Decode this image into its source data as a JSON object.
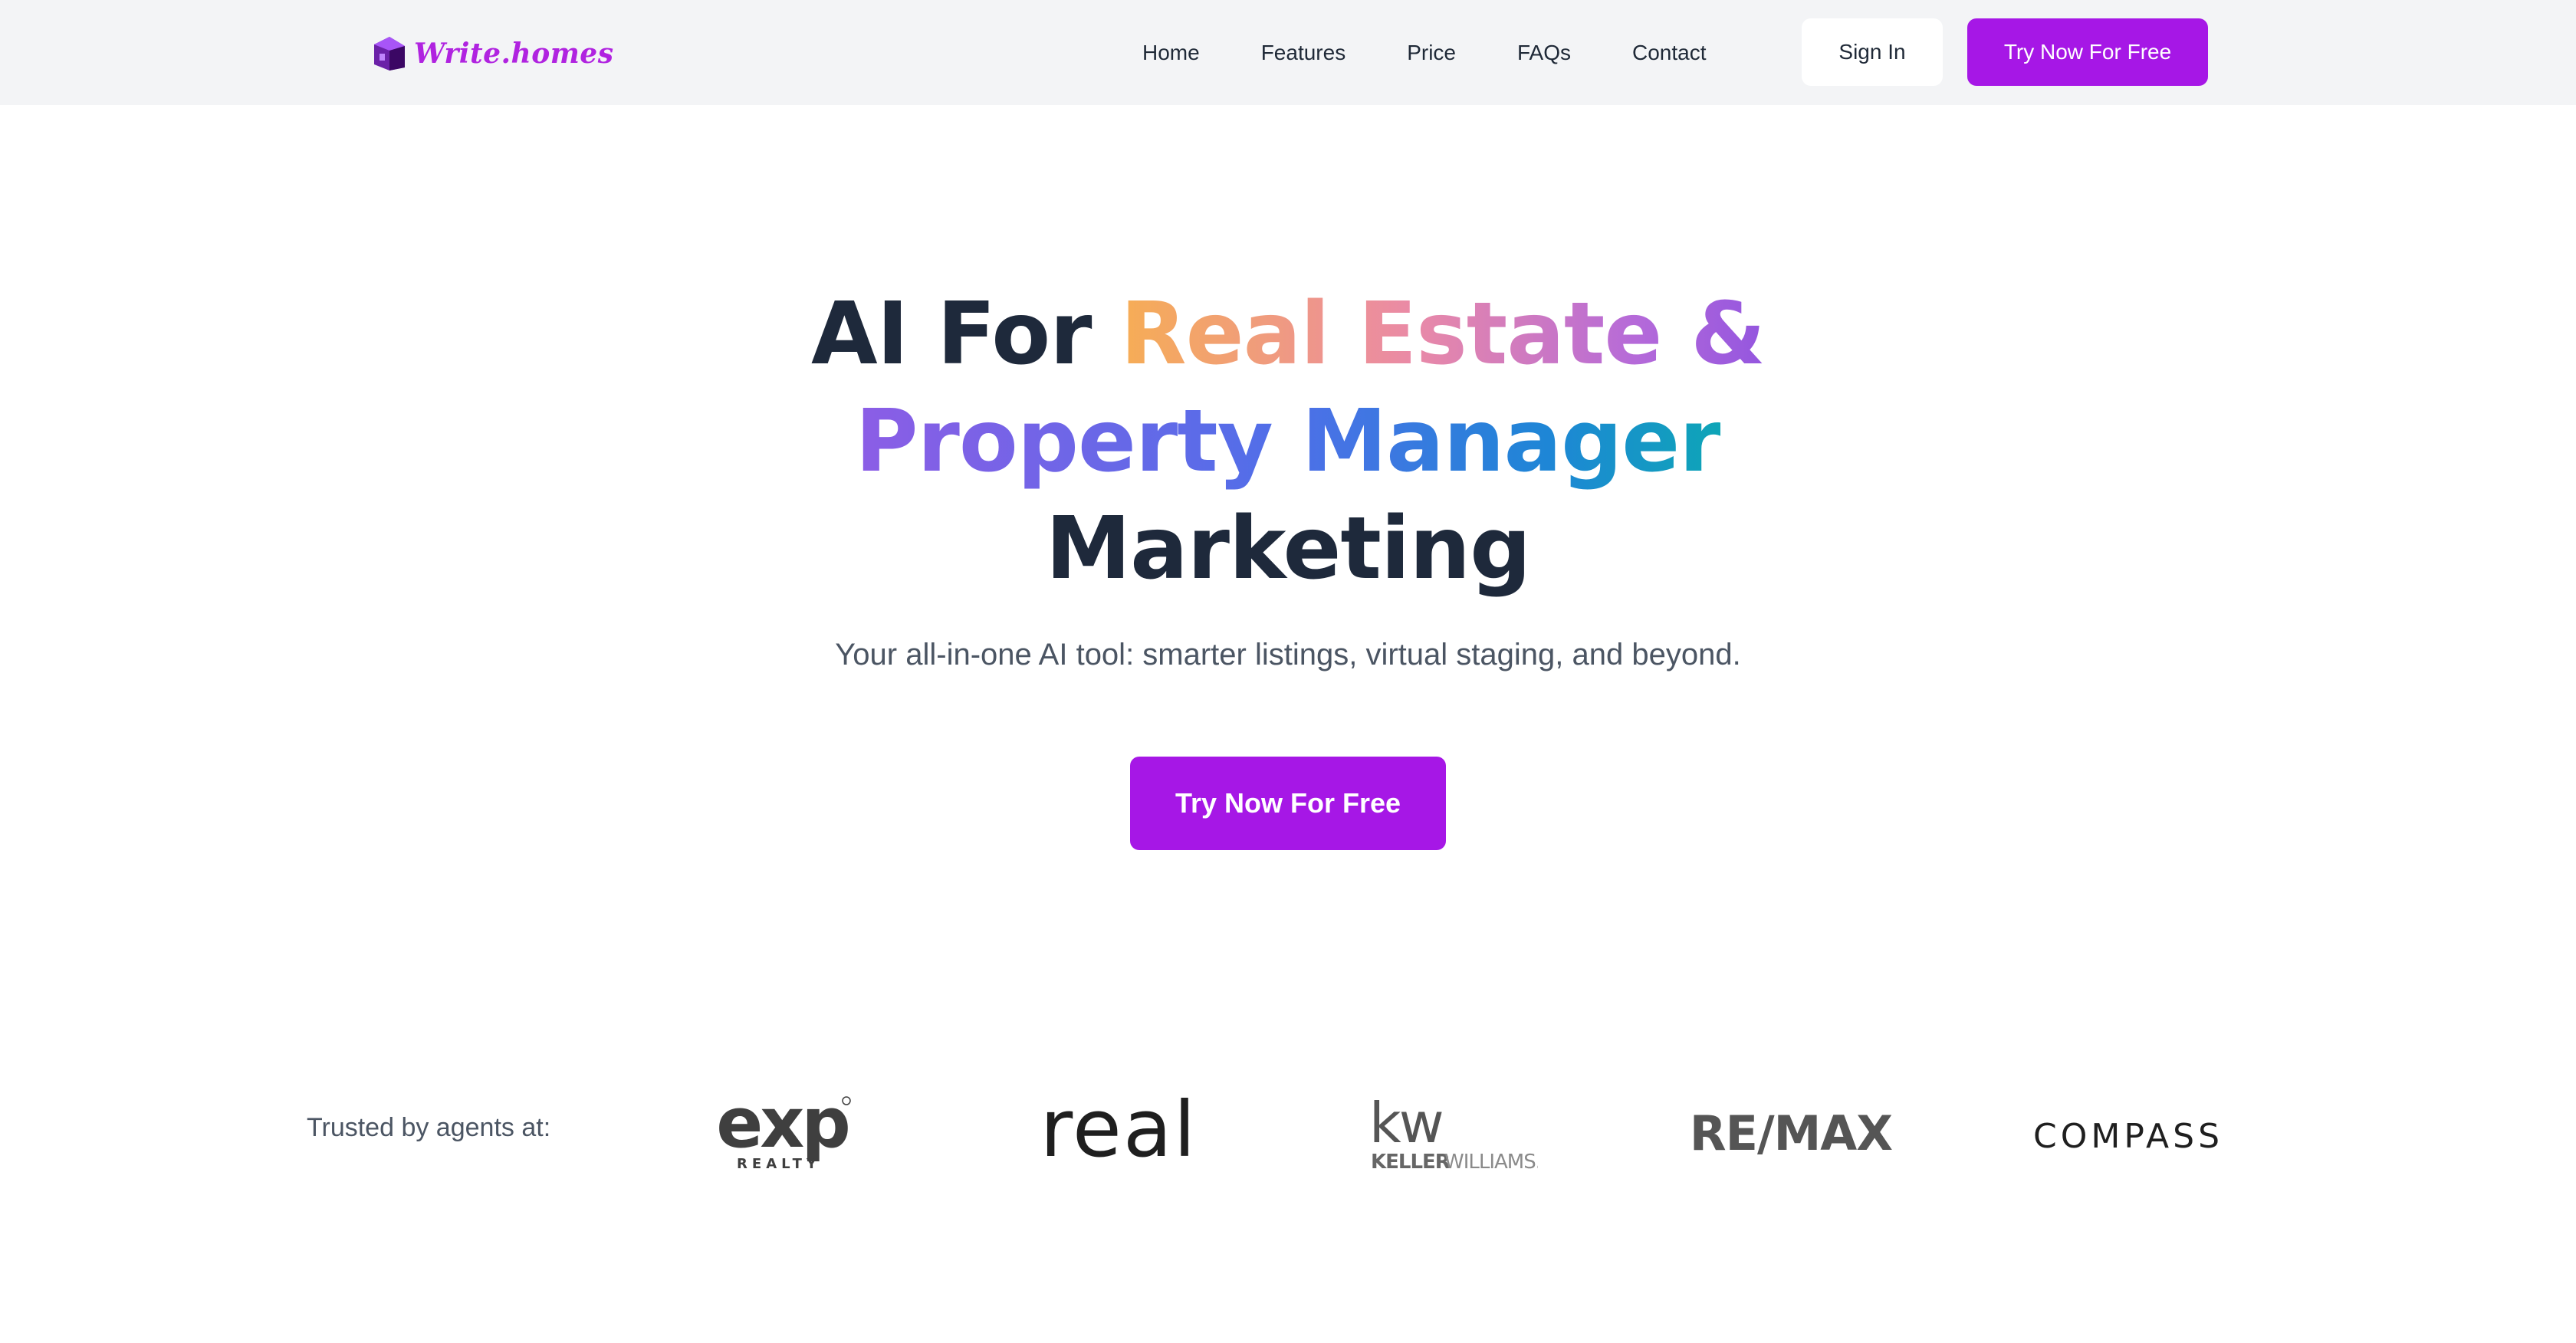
{
  "header": {
    "logo_text": "Write.homes",
    "nav": [
      "Home",
      "Features",
      "Price",
      "FAQs",
      "Contact"
    ],
    "sign_in_label": "Sign In",
    "try_label": "Try Now For Free"
  },
  "hero": {
    "title_part1": "AI For ",
    "title_part2": "Real Estate &",
    "title_part3": "Property Manager",
    "title_part4": "Marketing",
    "subtitle": "Your all-in-one AI tool: smarter listings, virtual staging, and beyond.",
    "cta_label": "Try Now For Free"
  },
  "trusted": {
    "label": "Trusted by agents at:",
    "brands": {
      "exp_main": "exp",
      "exp_sub": "REALTY",
      "real": "real",
      "kw_main": "kw",
      "kw_sub_1": "KELLER",
      "kw_sub_2": "WILLIAMS.",
      "remax": "RE/MAX",
      "compass": "COMPASS"
    }
  },
  "colors": {
    "accent": "#a617e6",
    "header_bg": "#f3f4f6",
    "heading": "#1e293b"
  }
}
